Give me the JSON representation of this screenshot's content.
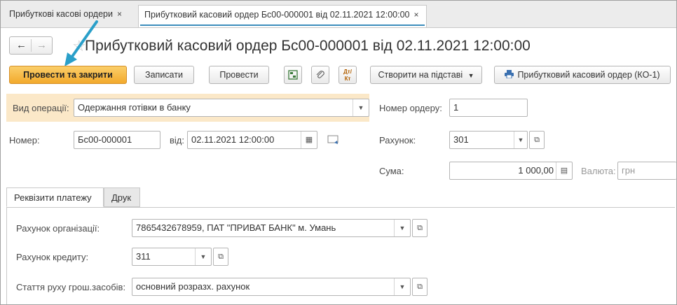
{
  "tabs": [
    {
      "label": "Прибуткові касові ордери",
      "close": "×"
    },
    {
      "label": "Прибутковий касовий ордер Бс00-000001 від 02.11.2021 12:00:00",
      "close": "×"
    }
  ],
  "header": {
    "back_icon": "←",
    "forward_icon": "→",
    "star_icon": "☆",
    "title": "Прибутковий касовий ордер Бс00-000001 від 02.11.2021 12:00:00"
  },
  "toolbar": {
    "post_close_label": "Провести та закрити",
    "save_label": "Записати",
    "post_label": "Провести",
    "structure_icon": "structure-icon",
    "attach_icon": "paperclip-icon",
    "dt_kt_icon": "Дт/Кт",
    "create_based_label": "Створити на підставі",
    "print_label": "Прибутковий касовий ордер (КО-1)"
  },
  "form": {
    "operation_label": "Вид операції:",
    "operation_value": "Одержання готівки в банку",
    "order_no_label": "Номер ордеру:",
    "order_no_value": "1",
    "number_label": "Номер:",
    "number_value": "Бс00-000001",
    "date_label": "від:",
    "date_value": "02.11.2021 12:00:00",
    "account_label": "Рахунок:",
    "account_value": "301",
    "sum_label": "Сума:",
    "sum_value": "1 000,00",
    "currency_label": "Валюта:",
    "currency_value": "грн"
  },
  "subtabs": [
    {
      "label": "Реквізити платежу"
    },
    {
      "label": "Друк"
    }
  ],
  "details": {
    "org_account_label": "Рахунок організації:",
    "org_account_value": "7865432678959, ПАТ \"ПРИВАТ БАНК\" м. Умань",
    "credit_account_label": "Рахунок кредиту:",
    "credit_account_value": "311",
    "cash_flow_label": "Стаття руху грош.засобів:",
    "cash_flow_value": "основний розразх. рахунок"
  },
  "colors": {
    "accent": "#f2a92c",
    "highlight": "#fbe8c8",
    "tab_underline": "#3c8dbc",
    "annotation_arrow": "#2a9fc9"
  }
}
